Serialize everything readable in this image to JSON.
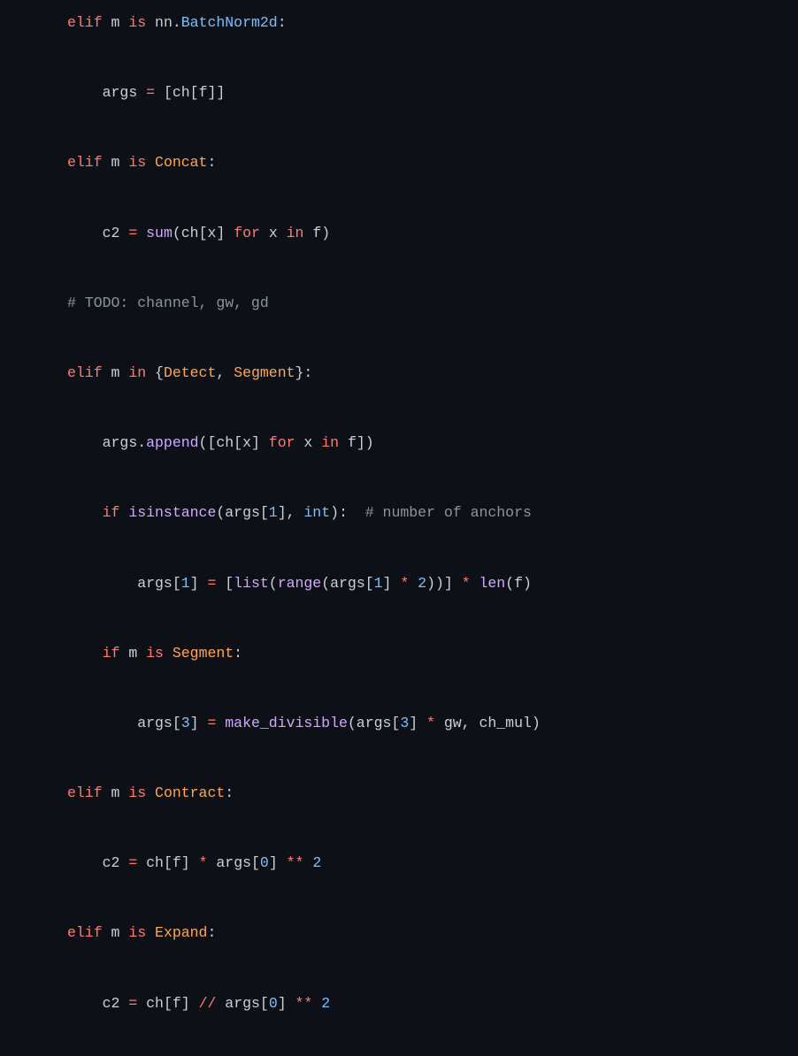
{
  "tokens": {
    "l1": {
      "t1": "elif",
      "t2": "m",
      "t3": "is",
      "t4": "nn",
      "t5": ".",
      "t6": "BatchNorm2d",
      "t7": ":"
    },
    "l2": {
      "t1": "args",
      "t2": "=",
      "t3": "[",
      "t4": "ch",
      "t5": "[",
      "t6": "f",
      "t7": "]",
      "t8": "]"
    },
    "l3": {
      "t1": "elif",
      "t2": "m",
      "t3": "is",
      "t4": "Concat",
      "t5": ":"
    },
    "l4": {
      "t1": "c2",
      "t2": "=",
      "t3": "sum",
      "t4": "(",
      "t5": "ch",
      "t6": "[",
      "t7": "x",
      "t8": "]",
      "t9": "for",
      "t10": "x",
      "t11": "in",
      "t12": "f",
      "t13": ")"
    },
    "l5": {
      "t1": "# TODO: channel, gw, gd"
    },
    "l6": {
      "t1": "elif",
      "t2": "m",
      "t3": "in",
      "t4": "{",
      "t5": "Detect",
      "t6": ",",
      "t7": "Segment",
      "t8": "}",
      "t9": ":"
    },
    "l7": {
      "t1": "args",
      "t2": ".",
      "t3": "append",
      "t4": "(",
      "t5": "[",
      "t6": "ch",
      "t7": "[",
      "t8": "x",
      "t9": "]",
      "t10": "for",
      "t11": "x",
      "t12": "in",
      "t13": "f",
      "t14": "]",
      "t15": ")"
    },
    "l8": {
      "t1": "if",
      "t2": "isinstance",
      "t3": "(",
      "t4": "args",
      "t5": "[",
      "t6": "1",
      "t7": "]",
      "t8": ",",
      "t9": "int",
      "t10": ")",
      "t11": ":",
      "t12": "# number of anchors"
    },
    "l9": {
      "t1": "args",
      "t2": "[",
      "t3": "1",
      "t4": "]",
      "t5": "=",
      "t6": "[",
      "t7": "list",
      "t8": "(",
      "t9": "range",
      "t10": "(",
      "t11": "args",
      "t12": "[",
      "t13": "1",
      "t14": "]",
      "t15": "*",
      "t16": "2",
      "t17": ")",
      "t18": ")",
      "t19": "]",
      "t20": "*",
      "t21": "len",
      "t22": "(",
      "t23": "f",
      "t24": ")"
    },
    "l10": {
      "t1": "if",
      "t2": "m",
      "t3": "is",
      "t4": "Segment",
      "t5": ":"
    },
    "l11": {
      "t1": "args",
      "t2": "[",
      "t3": "3",
      "t4": "]",
      "t5": "=",
      "t6": "make_divisible",
      "t7": "(",
      "t8": "args",
      "t9": "[",
      "t10": "3",
      "t11": "]",
      "t12": "*",
      "t13": "gw",
      "t14": ",",
      "t15": "ch_mul",
      "t16": ")"
    },
    "l12": {
      "t1": "elif",
      "t2": "m",
      "t3": "is",
      "t4": "Contract",
      "t5": ":"
    },
    "l13": {
      "t1": "c2",
      "t2": "=",
      "t3": "ch",
      "t4": "[",
      "t5": "f",
      "t6": "]",
      "t7": "*",
      "t8": "args",
      "t9": "[",
      "t10": "0",
      "t11": "]",
      "t12": "**",
      "t13": "2"
    },
    "l14": {
      "t1": "elif",
      "t2": "m",
      "t3": "is",
      "t4": "Expand",
      "t5": ":"
    },
    "l15": {
      "t1": "c2",
      "t2": "=",
      "t3": "ch",
      "t4": "[",
      "t5": "f",
      "t6": "]",
      "t7": "//",
      "t8": "args",
      "t9": "[",
      "t10": "0",
      "t11": "]",
      "t12": "**",
      "t13": "2"
    }
  }
}
